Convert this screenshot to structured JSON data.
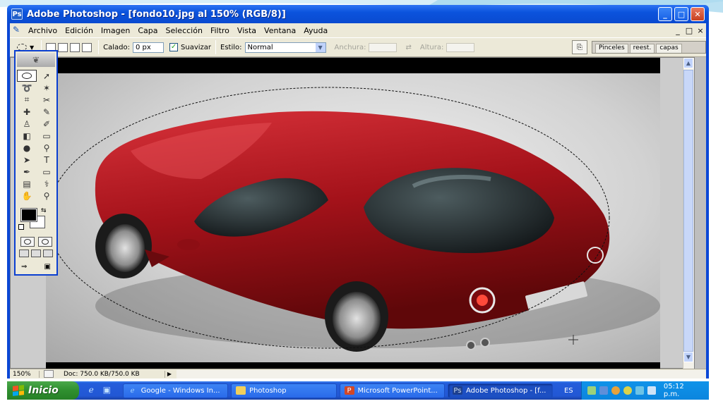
{
  "window": {
    "title": "Adobe Photoshop - [fondo10.jpg al 150% (RGB/8)]",
    "buttons": {
      "minimize": "_",
      "maximize": "□",
      "close": "✕"
    }
  },
  "menubar": {
    "items": [
      "Archivo",
      "Edición",
      "Imagen",
      "Capa",
      "Selección",
      "Filtro",
      "Vista",
      "Ventana",
      "Ayuda"
    ],
    "mdi": {
      "minimize": "_",
      "restore": "□",
      "close": "×"
    }
  },
  "options": {
    "feather_label": "Calado:",
    "feather_value": "0 px",
    "antialias_label": "Suavizar",
    "style_label": "Estilo:",
    "style_value": "Normal",
    "width_label": "Anchura:",
    "height_label": "Altura:",
    "palette_tabs": [
      "Pinceles",
      "reest.",
      "capas"
    ]
  },
  "status": {
    "zoom": "150%",
    "doc": "Doc: 750.0 KB/750.0 KB"
  },
  "taskbar": {
    "start_label": "Inicio",
    "tasks": [
      {
        "label": "Google - Windows In...",
        "icon": "ie-icon"
      },
      {
        "label": "Photoshop",
        "icon": "folder-icon"
      },
      {
        "label": "Microsoft PowerPoint...",
        "icon": "powerpoint-icon"
      },
      {
        "label": "Adobe Photoshop - [f...",
        "icon": "photoshop-icon"
      }
    ],
    "language": "ES",
    "clock": "05:12 p.m."
  },
  "colors": {
    "xp_blue": "#0a47d6",
    "chrome": "#ece9d8",
    "car_red": "#b3141b",
    "start_green": "#2f8f2f"
  }
}
